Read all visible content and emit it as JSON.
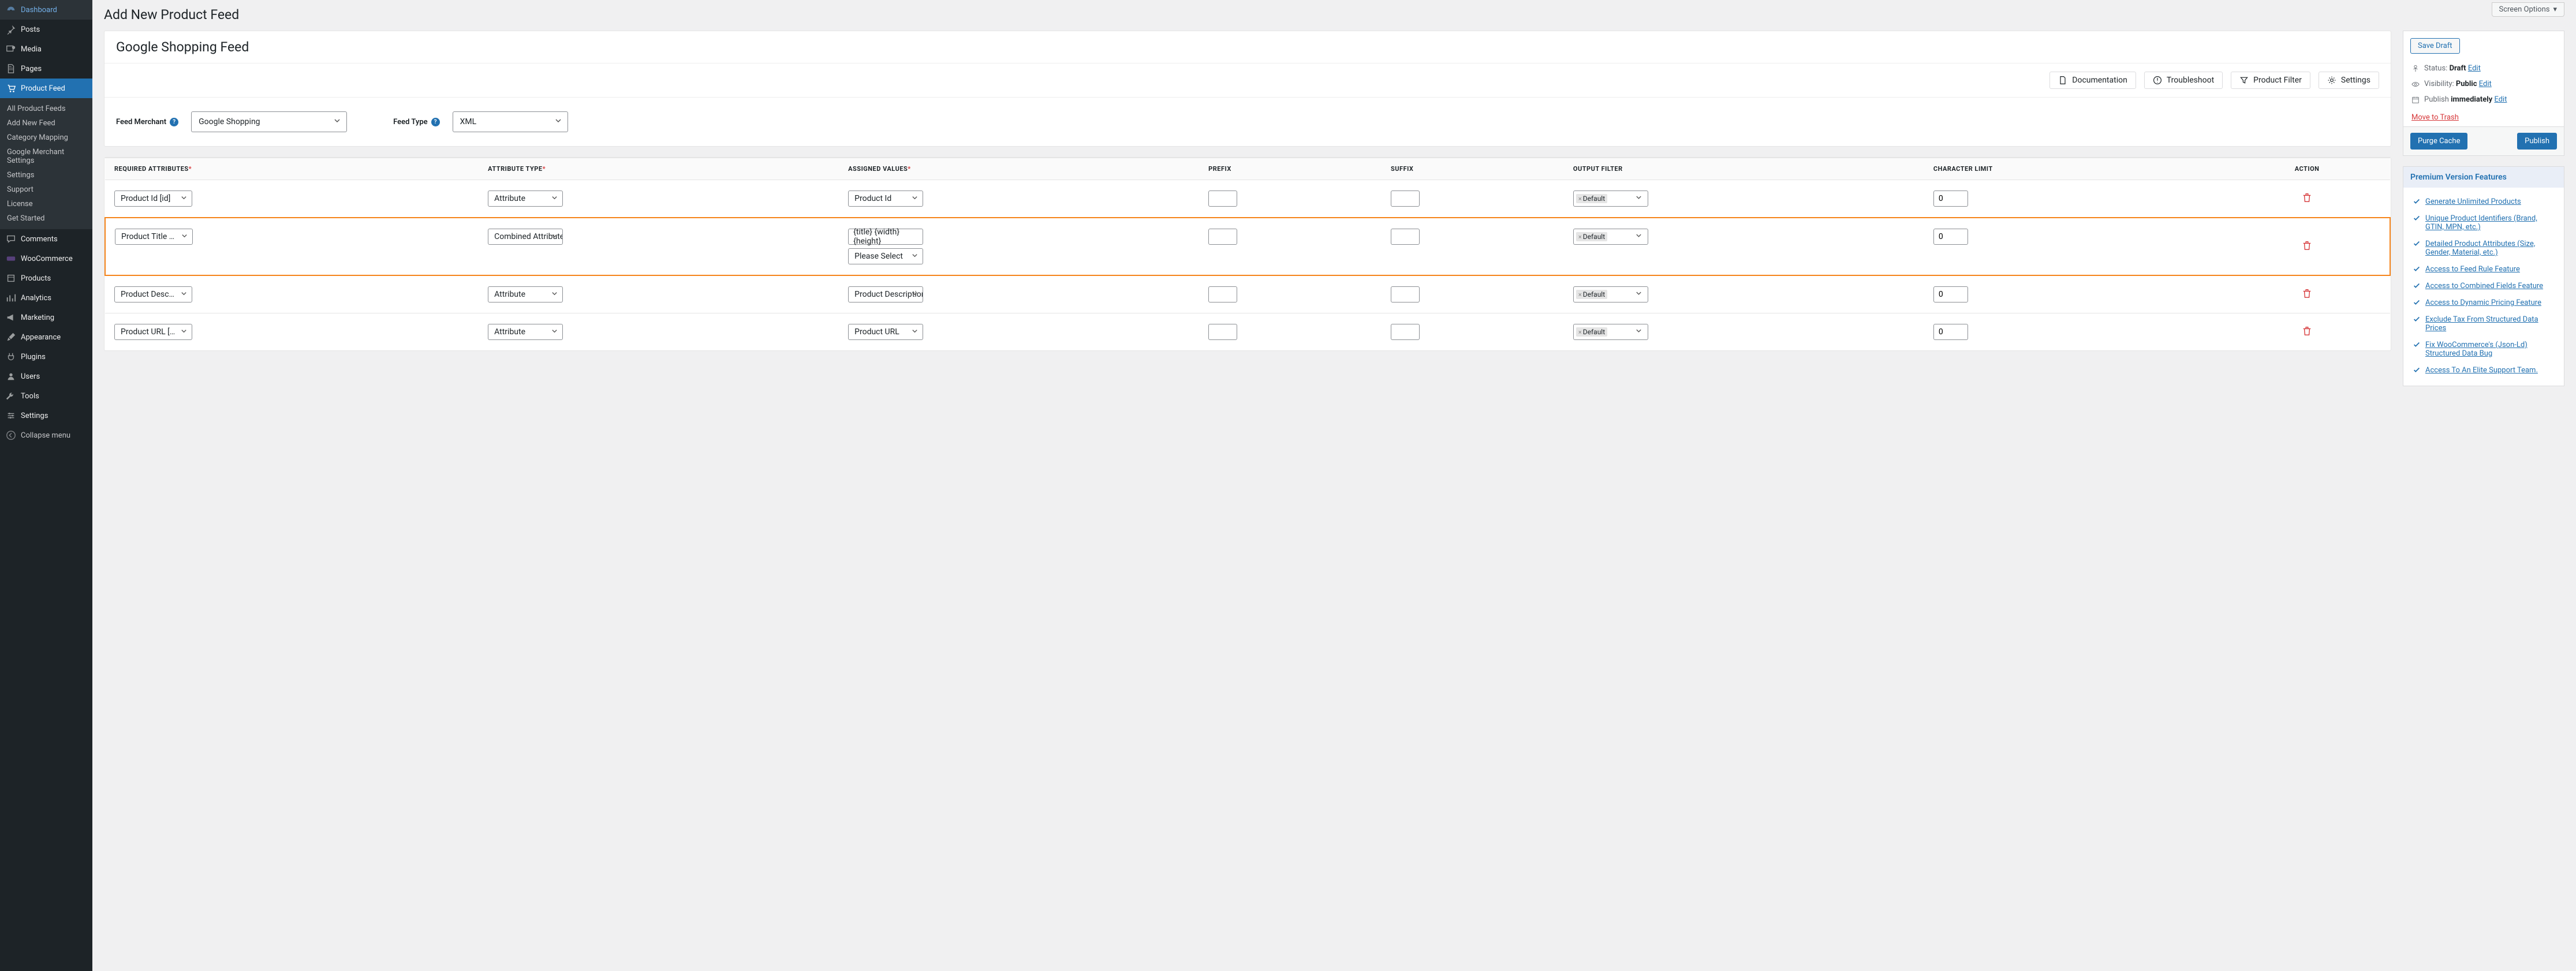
{
  "screen_options": "Screen Options",
  "page_title": "Add New Product Feed",
  "nav": [
    {
      "label": "Dashboard",
      "icon": "dashboard"
    },
    {
      "label": "Posts",
      "icon": "pin"
    },
    {
      "label": "Media",
      "icon": "media"
    },
    {
      "label": "Pages",
      "icon": "page"
    },
    {
      "label": "Product Feed",
      "icon": "cart",
      "active": true,
      "submenu": [
        "All Product Feeds",
        "Add New Feed",
        "Category Mapping",
        "Google Merchant Settings",
        "Settings",
        "Support",
        "License",
        "Get Started"
      ]
    },
    {
      "label": "Comments",
      "icon": "comment"
    },
    {
      "label": "WooCommerce",
      "icon": "woo"
    },
    {
      "label": "Products",
      "icon": "product"
    },
    {
      "label": "Analytics",
      "icon": "chart"
    },
    {
      "label": "Marketing",
      "icon": "megaphone"
    },
    {
      "label": "Appearance",
      "icon": "brush"
    },
    {
      "label": "Plugins",
      "icon": "plug"
    },
    {
      "label": "Users",
      "icon": "user"
    },
    {
      "label": "Tools",
      "icon": "wrench"
    },
    {
      "label": "Settings",
      "icon": "sliders"
    }
  ],
  "collapse_label": "Collapse menu",
  "feed_title": "Google Shopping Feed",
  "header_actions": [
    {
      "label": "Documentation",
      "icon": "doc"
    },
    {
      "label": "Troubleshoot",
      "icon": "alert"
    },
    {
      "label": "Product Filter",
      "icon": "filter"
    },
    {
      "label": "Settings",
      "icon": "gear"
    }
  ],
  "feed_merchant_label": "Feed Merchant",
  "feed_merchant_value": "Google Shopping",
  "feed_type_label": "Feed Type",
  "feed_type_value": "XML",
  "table_headers": {
    "required_attr": "Required Attributes",
    "attr_type": "Attribute Type",
    "assigned": "Assigned Values",
    "prefix": "Prefix",
    "suffix": "Suffix",
    "output_filter": "Output Filter",
    "char_limit": "Character Limit",
    "action": "Action"
  },
  "rows": [
    {
      "attr": "Product Id [id]",
      "type": "Attribute",
      "assigned": "Product Id",
      "filter": "Default",
      "limit": "0"
    },
    {
      "attr": "Product Title [title]",
      "type": "Combined Attributes",
      "assigned": "{title} {width} {height}",
      "assigned2": "Please Select",
      "filter": "Default",
      "limit": "0",
      "highlight": true
    },
    {
      "attr": "Product Description [description]",
      "type": "Attribute",
      "assigned": "Product Description",
      "filter": "Default",
      "limit": "0"
    },
    {
      "attr": "Product URL [link]",
      "type": "Attribute",
      "assigned": "Product URL",
      "filter": "Default",
      "limit": "0"
    }
  ],
  "publish": {
    "save_draft": "Save Draft",
    "status_label": "Status:",
    "status_value": "Draft",
    "visibility_label": "Visibility:",
    "visibility_value": "Public",
    "publish_label": "Publish",
    "publish_value": "immediately",
    "edit": "Edit",
    "trash": "Move to Trash",
    "purge": "Purge Cache",
    "publish_btn": "Publish"
  },
  "premium": {
    "title": "Premium Version Features",
    "features": [
      "Generate Unlimited Products",
      "Unique Product Identifiers (Brand, GTIN, MPN, etc.)",
      "Detailed Product Attributes (Size, Gender, Material, etc.)",
      "Access to Feed Rule Feature",
      "Access to Combined Fields Feature",
      "Access to Dynamic Pricing Feature",
      "Exclude Tax From Structured Data Prices",
      "Fix WooCommerce's (Json-Ld) Structured Data Bug",
      "Access To An Elite Support Team."
    ]
  }
}
